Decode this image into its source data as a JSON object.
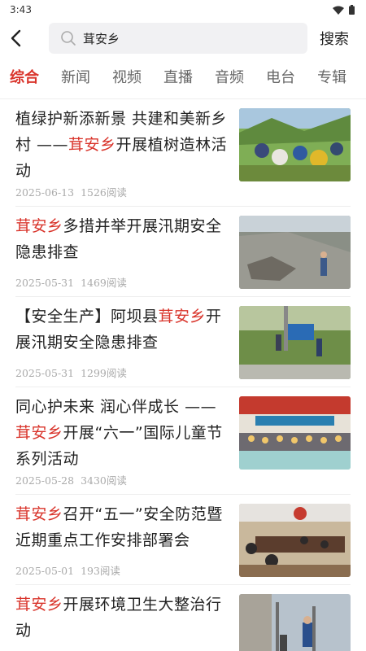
{
  "status_bar": {
    "time": "3:43"
  },
  "search": {
    "query": "茸安乡",
    "button_label": "搜索"
  },
  "tabs": [
    {
      "label": "综合",
      "active": true
    },
    {
      "label": "新闻",
      "active": false
    },
    {
      "label": "视频",
      "active": false
    },
    {
      "label": "直播",
      "active": false
    },
    {
      "label": "音频",
      "active": false
    },
    {
      "label": "电台",
      "active": false
    },
    {
      "label": "专辑",
      "active": false
    }
  ],
  "highlight_color": "#d9342b",
  "articles": [
    {
      "title_segments": [
        "植绿护新添新景  共建和美新乡村 ——",
        "茸安乡",
        "开展植树造林活动"
      ],
      "date": "2025-06-13",
      "reads": "1526阅读",
      "image_icon": "tree-planting-photo"
    },
    {
      "title_segments": [
        "",
        "茸安乡",
        "多措并举开展汛期安全隐患排查"
      ],
      "date": "2025-05-31",
      "reads": "1469阅读",
      "image_icon": "landslide-inspection-photo"
    },
    {
      "title_segments": [
        "【安全生产】阿坝县",
        "茸安乡",
        "开展汛期安全隐患排查"
      ],
      "date": "2025-05-31",
      "reads": "1299阅读",
      "image_icon": "sign-inspection-photo"
    },
    {
      "title_segments": [
        "同心护未来 润心伴成长 ——",
        "茸安乡",
        "开展“六一”国际儿童节系列活动"
      ],
      "date": "2025-05-28",
      "reads": "3430阅读",
      "image_icon": "childrens-day-photo"
    },
    {
      "title_segments": [
        "",
        "茸安乡",
        "召开“五一”安全防范暨近期重点工作安排部署会"
      ],
      "date": "2025-05-01",
      "reads": "193阅读",
      "image_icon": "meeting-room-photo"
    },
    {
      "title_segments": [
        "",
        "茸安乡",
        "开展环境卫生大整治行动"
      ],
      "date": "",
      "reads": "",
      "image_icon": "street-cleanup-photo"
    }
  ]
}
